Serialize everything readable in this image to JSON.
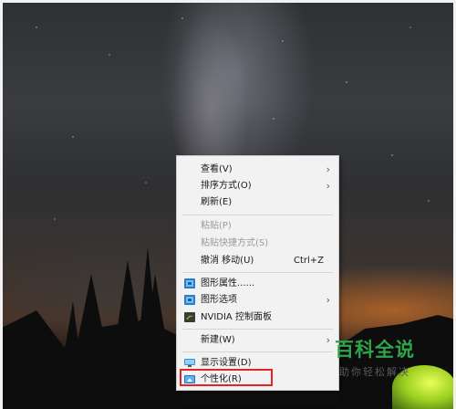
{
  "context_menu": {
    "items": [
      {
        "label": "查看(V)",
        "has_submenu": true,
        "enabled": true
      },
      {
        "label": "排序方式(O)",
        "has_submenu": true,
        "enabled": true
      },
      {
        "label": "刷新(E)",
        "has_submenu": false,
        "enabled": true
      },
      {
        "label": "粘贴(P)",
        "has_submenu": false,
        "enabled": false
      },
      {
        "label": "粘贴快捷方式(S)",
        "has_submenu": false,
        "enabled": false
      },
      {
        "label": "撤消 移动(U)",
        "shortcut": "Ctrl+Z",
        "has_submenu": false,
        "enabled": true
      },
      {
        "label": "图形属性......",
        "icon": "intel-graphics-icon",
        "has_submenu": false,
        "enabled": true
      },
      {
        "label": "图形选项",
        "icon": "intel-graphics-icon",
        "has_submenu": true,
        "enabled": true
      },
      {
        "label": "NVIDIA 控制面板",
        "icon": "nvidia-icon",
        "has_submenu": false,
        "enabled": true
      },
      {
        "label": "新建(W)",
        "has_submenu": true,
        "enabled": true
      },
      {
        "label": "显示设置(D)",
        "icon": "display-icon",
        "has_submenu": false,
        "enabled": true
      },
      {
        "label": "个性化(R)",
        "icon": "personalize-icon",
        "has_submenu": false,
        "enabled": true,
        "highlighted": true
      }
    ]
  },
  "watermark": {
    "logo_text": "百科全说",
    "sub_text": "助你轻松解决"
  },
  "colors": {
    "highlight_border": "#e0242a",
    "watermark_green": "#2fa44a",
    "menu_background": "#f2f2f2"
  }
}
